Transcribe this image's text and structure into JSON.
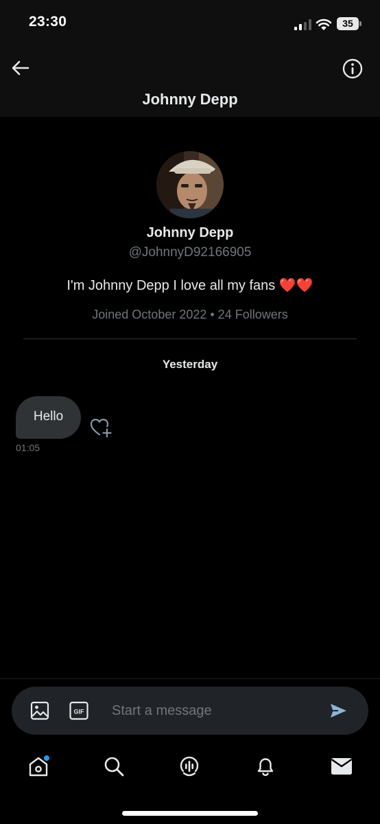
{
  "status": {
    "time": "23:30",
    "battery": "35"
  },
  "header": {
    "title": "Johnny Depp"
  },
  "profile": {
    "name": "Johnny Depp",
    "handle": "@JohnnyD92166905",
    "bio": "I'm Johnny Depp I love all my fans ❤️❤️",
    "meta": "Joined October 2022 • 24 Followers"
  },
  "conversation": {
    "date_label": "Yesterday",
    "messages": [
      {
        "text": "Hello",
        "time": "01:05"
      }
    ]
  },
  "composer": {
    "placeholder": "Start a message",
    "gif_label": "GIF"
  },
  "tabs": [
    "home-icon",
    "search-icon",
    "spaces-icon",
    "notifications-icon",
    "messages-icon"
  ],
  "colors": {
    "accent": "#1d9bf0",
    "background": "#000000",
    "secondary_text": "#71767b",
    "bubble": "#2f3336"
  }
}
